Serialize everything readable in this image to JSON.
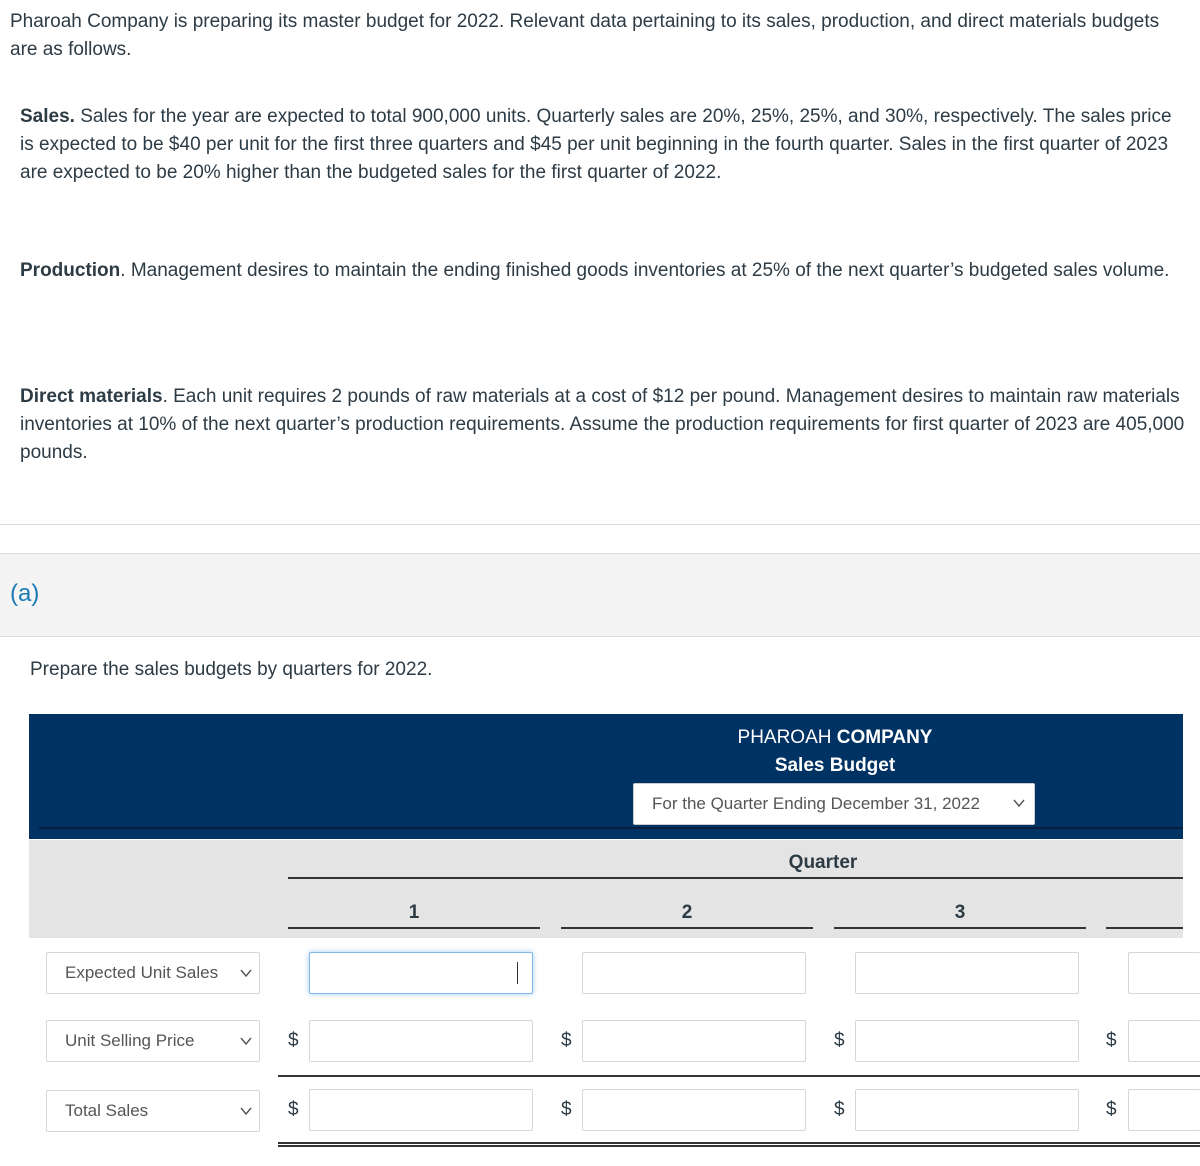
{
  "problem": {
    "intro": "Pharoah Company is preparing its master budget for 2022. Relevant data pertaining to its sales, production, and direct materials budgets are as follows.",
    "sales": {
      "heading": "Sales.",
      "text": " Sales for the year are expected to total 900,000 units. Quarterly sales are 20%, 25%, 25%, and 30%, respectively. The sales price is expected to be $40 per unit for the first three quarters and $45 per unit beginning in the fourth quarter. Sales in the first quarter of 2023 are expected to be 20% higher than the budgeted sales for the first quarter of 2022."
    },
    "production": {
      "heading": "Production",
      "text": ". Management desires to maintain the ending finished goods inventories at 25% of the next quarter’s budgeted sales volume."
    },
    "direct_materials": {
      "heading": "Direct materials",
      "text": ". Each unit requires 2 pounds of raw materials at a cost of $12 per pound. Management desires to maintain raw materials inventories at 10% of the next quarter’s production requirements. Assume the production requirements for first quarter of 2023 are 405,000 pounds."
    }
  },
  "part": {
    "label": "(a)",
    "instruction": "Prepare the sales budgets by quarters for 2022."
  },
  "table": {
    "company_regular": "PHAROAH ",
    "company_bold": "COMPANY",
    "title": "Sales Budget",
    "period_selected": "For the Quarter Ending December 31, 2022",
    "group_header": "Quarter",
    "columns": [
      "1",
      "2",
      "3"
    ],
    "currency_symbol": "$",
    "rows": [
      {
        "label": "Expected Unit Sales",
        "values": [
          "",
          "",
          "",
          ""
        ]
      },
      {
        "label": "Unit Selling Price",
        "values": [
          "",
          "",
          "",
          ""
        ]
      },
      {
        "label": "Total Sales",
        "values": [
          "",
          "",
          "",
          ""
        ]
      }
    ]
  },
  "colors": {
    "header_navy": "#003263",
    "part_label_blue": "#1a7ab3",
    "header_gray": "#e4e4e4",
    "focus_blue": "#7fb8e8"
  }
}
